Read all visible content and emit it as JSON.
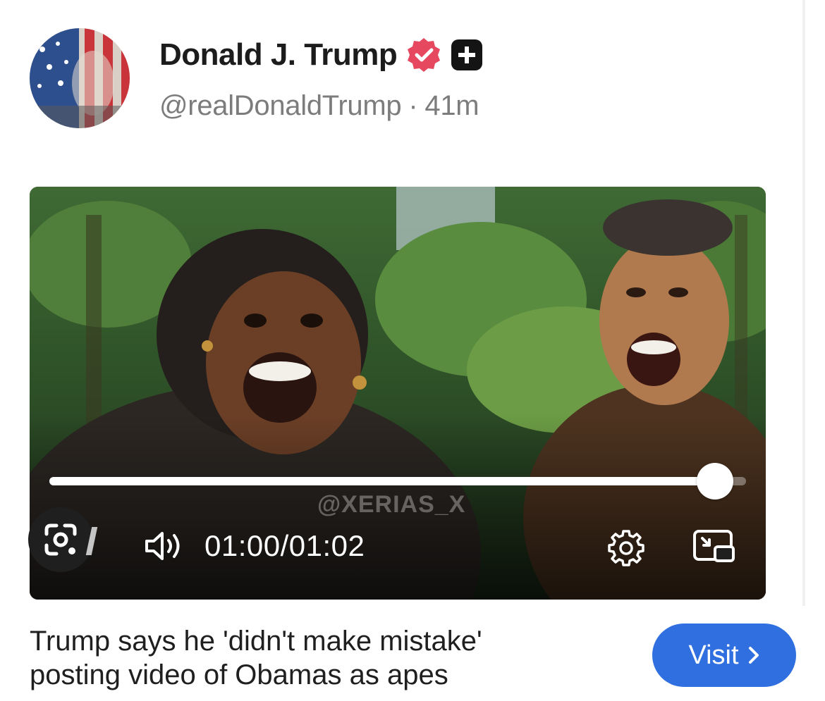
{
  "post": {
    "author_name": "Donald J. Trump",
    "handle": "@realDonaldTrump",
    "separator": "·",
    "time_ago": "41m"
  },
  "video": {
    "watermark": "@XERIAS_X",
    "current_time": "01:00",
    "duration": "01:02",
    "time_separator": "/",
    "progress": 0.955
  },
  "caption": {
    "line1": "Trump says he 'didn't make mistake'",
    "line2": "posting video of Obamas as apes"
  },
  "visit_button": {
    "label": "Visit",
    "chevron": "›"
  },
  "colors": {
    "verified_badge": "#e5485f",
    "visit_button": "#2f6fe0",
    "handle_text": "#7c7c7c"
  },
  "icons": [
    "verified-badge-icon",
    "plus-square-icon",
    "volume-icon",
    "gear-icon",
    "picture-in-picture-icon",
    "lens-search-icon"
  ]
}
